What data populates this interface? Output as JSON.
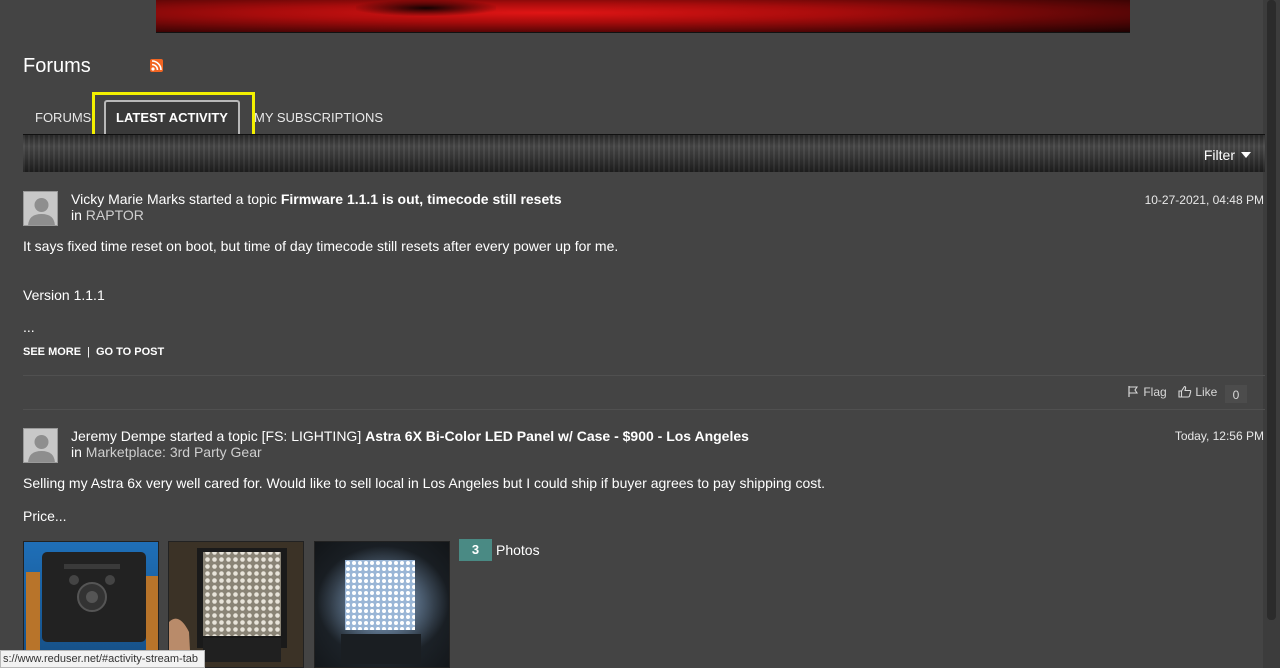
{
  "page": {
    "title": "Forums"
  },
  "tabs": [
    {
      "label": "FORUMS",
      "active": false
    },
    {
      "label": "LATEST ACTIVITY",
      "active": true
    },
    {
      "label": "MY SUBSCRIPTIONS",
      "active": false
    }
  ],
  "filter": {
    "label": "Filter"
  },
  "posts": [
    {
      "author": "Vicky Marie Marks",
      "action": "started a topic",
      "topic_prefix": "",
      "topic_title": "Firmware 1.1.1 is out, timecode still resets",
      "in_label": "in",
      "forum": "RAPTOR",
      "timestamp": "10-27-2021, 04:48 PM",
      "body_lines": [
        "It says fixed time reset on boot, but time of day timecode still resets after every power up for me.",
        "Version 1.1.1",
        "..."
      ],
      "see_more": "SEE MORE",
      "go_to_post": "GO TO POST",
      "separator": "|",
      "flag_label": "Flag",
      "like_label": "Like",
      "like_count": "0"
    },
    {
      "author": "Jeremy Dempe",
      "action": "started a topic",
      "topic_prefix": "[FS: LIGHTING]",
      "topic_title": "Astra 6X Bi-Color LED Panel w/ Case - $900 - Los Angeles",
      "in_label": "in",
      "forum": "Marketplace: 3rd Party Gear",
      "timestamp": "Today, 12:56 PM",
      "body_lines": [
        "Selling my Astra 6x very well cared for. Would like to sell local in Los Angeles but I could ship if buyer agrees to pay shipping cost.",
        "Price..."
      ],
      "photo_count": "3",
      "photos_label": "Photos"
    }
  ],
  "status_bar": {
    "url": "s://www.reduser.net/#activity-stream-tab"
  },
  "colors": {
    "highlight": "#f3f000",
    "background": "#444444",
    "photo_badge": "#4a8a84",
    "rss": "#f26522"
  }
}
